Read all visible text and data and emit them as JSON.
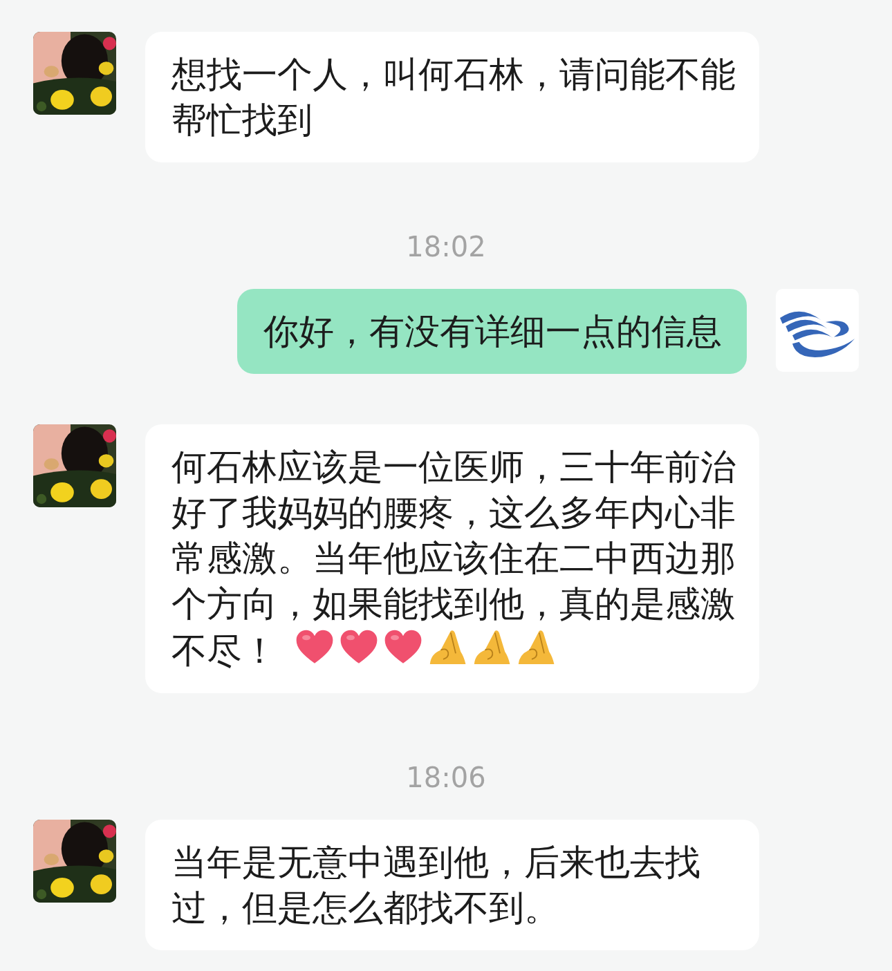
{
  "messages": [
    {
      "kind": "incoming",
      "text": "想找一个人，叫何石林，请问能不能帮忙找到"
    },
    {
      "kind": "timestamp",
      "text": "18:02"
    },
    {
      "kind": "outgoing",
      "text": "你好，有没有详细一点的信息"
    },
    {
      "kind": "incoming",
      "text": "何石林应该是一位医师，三十年前治好了我妈妈的腰疼，这么多年内心非常感激。当年他应该住在二中西边那个方向，如果能找到他，真的是感激不尽！",
      "emojis": [
        {
          "kind": "heart"
        },
        {
          "kind": "heart"
        },
        {
          "kind": "heart"
        },
        {
          "kind": "pray"
        },
        {
          "kind": "pray"
        },
        {
          "kind": "pray"
        }
      ]
    },
    {
      "kind": "timestamp",
      "text": "18:06"
    },
    {
      "kind": "incoming",
      "text": "当年是无意中遇到他，后来也去找过，但是怎么都找不到。"
    }
  ]
}
